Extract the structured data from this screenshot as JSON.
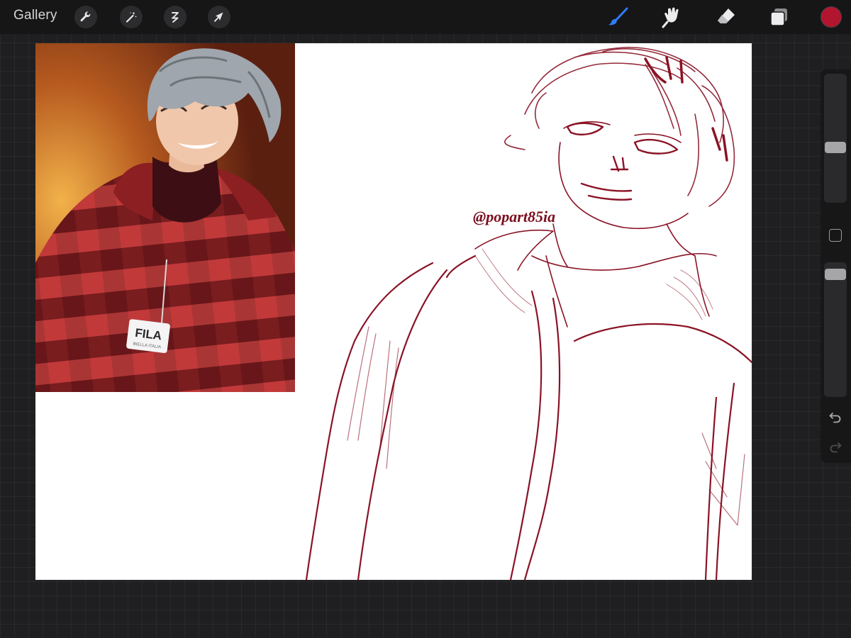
{
  "topbar": {
    "gallery_label": "Gallery",
    "left_tools": [
      {
        "icon": "wrench-icon",
        "name": "actions"
      },
      {
        "icon": "magic-wand-icon",
        "name": "adjustments"
      },
      {
        "icon": "selection-icon",
        "name": "selection"
      },
      {
        "icon": "arrow-icon",
        "name": "transform"
      }
    ],
    "right_tools": [
      {
        "icon": "brush-icon",
        "name": "paint",
        "active": true
      },
      {
        "icon": "smudge-icon",
        "name": "smudge",
        "active": false
      },
      {
        "icon": "eraser-icon",
        "name": "erase",
        "active": false
      },
      {
        "icon": "layers-icon",
        "name": "layers",
        "active": false
      }
    ],
    "current_color": "#b21530",
    "active_tool_color": "#2f7cf6"
  },
  "canvas": {
    "reference_photo": {
      "logo_text": "FILA",
      "logo_subtext": "BIELLA ITALIA"
    },
    "sketch": {
      "signature_text": "@popart85ia",
      "stroke_color": "#8a1326"
    }
  },
  "sidebar": {
    "brush_size_level": 0.42,
    "opacity_level": 0.05,
    "undo_icon": "undo-icon",
    "redo_icon": "redo-icon"
  }
}
